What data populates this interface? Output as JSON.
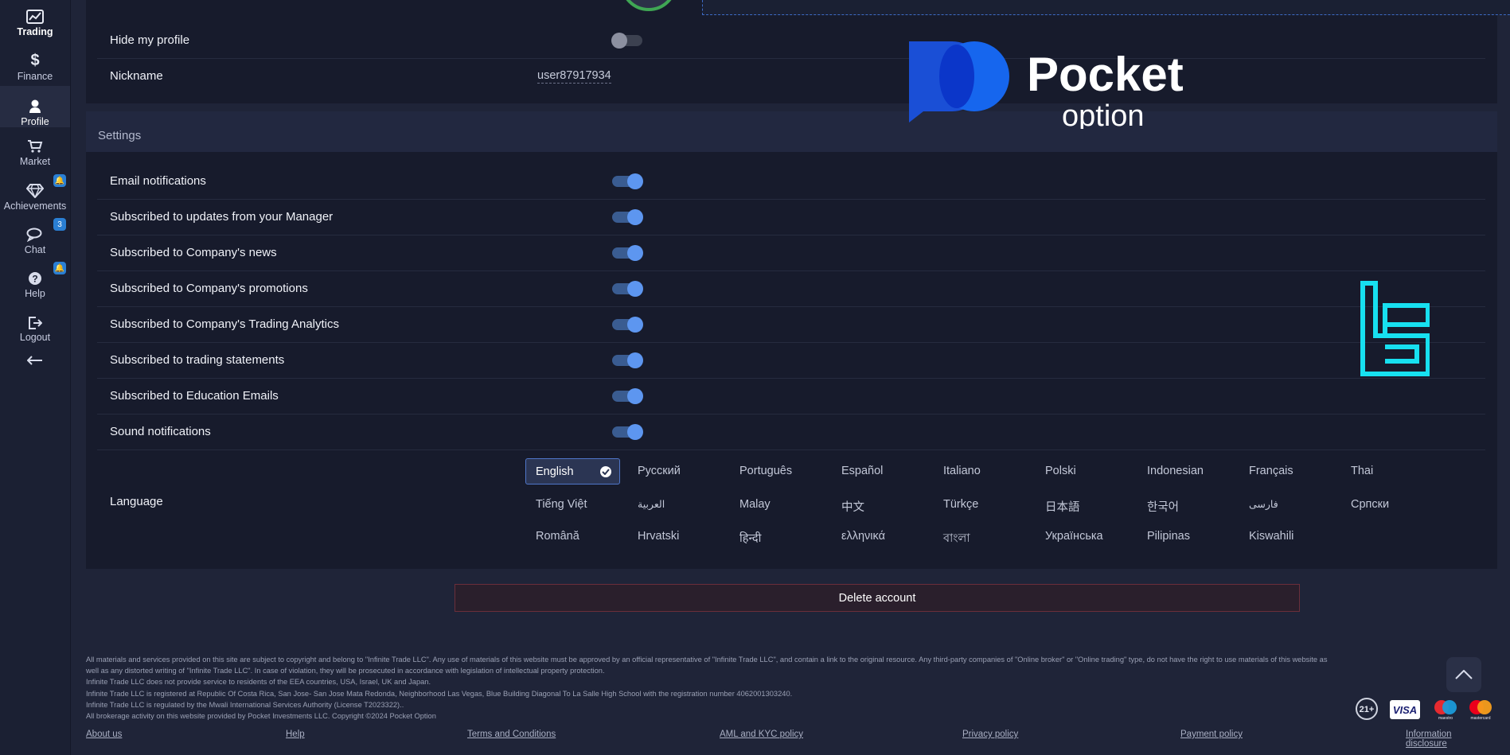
{
  "sidebar": {
    "items": [
      {
        "label": "Trading",
        "icon": "trading-chart-icon"
      },
      {
        "label": "Finance",
        "icon": "dollar-icon"
      },
      {
        "label": "Profile",
        "icon": "user-icon"
      },
      {
        "label": "Market",
        "icon": "cart-icon"
      },
      {
        "label": "Achievements",
        "icon": "diamond-icon"
      },
      {
        "label": "Chat",
        "icon": "chat-icon",
        "badge": "3"
      },
      {
        "label": "Help",
        "icon": "help-icon"
      },
      {
        "label": "Logout",
        "icon": "logout-icon"
      }
    ],
    "active": "Profile",
    "collapse_icon": "arrow-left-icon"
  },
  "profile": {
    "hide_label": "Hide my profile",
    "hide_enabled": false,
    "nickname_label": "Nickname",
    "nickname_value": "user87917934"
  },
  "brand": {
    "word1": "Pocket",
    "word2": "option"
  },
  "settings": {
    "title": "Settings",
    "items": [
      {
        "label": "Email notifications",
        "enabled": true
      },
      {
        "label": "Subscribed to updates from your Manager",
        "enabled": true
      },
      {
        "label": "Subscribed to Company's news",
        "enabled": true
      },
      {
        "label": "Subscribed to Company's promotions",
        "enabled": true
      },
      {
        "label": "Subscribed to Company's Trading Analytics",
        "enabled": true
      },
      {
        "label": "Subscribed to trading statements",
        "enabled": true
      },
      {
        "label": "Subscribed to Education Emails",
        "enabled": true
      },
      {
        "label": "Sound notifications",
        "enabled": true
      }
    ],
    "language_label": "Language",
    "selected_language": "English",
    "languages": [
      "English",
      "Русский",
      "Português",
      "Español",
      "Italiano",
      "Polski",
      "Indonesian",
      "Français",
      "Thai",
      "Tiếng Việt",
      "العربية",
      "Malay",
      "中文",
      "Türkçe",
      "日本語",
      "한국어",
      "فارسی",
      "Српски",
      "Română",
      "Hrvatski",
      "हिन्दी",
      "ελληνικά",
      "বাংলা",
      "Українська",
      "Pilipinas",
      "Kiswahili"
    ]
  },
  "delete_account": "Delete account",
  "disclaimer": [
    "All materials and services provided on this site are subject to copyright and belong to \"Infinite Trade LLC\". Any use of materials of this website must be approved by an official representative of \"Infinite Trade LLC\", and contain a link to the original resource. Any third-party companies of \"Online broker\" or \"Online trading\" type, do not have the right to use materials of this website as",
    "well as any distorted writing of \"Infinite Trade LLC\". In case of violation, they will be prosecuted in accordance with legislation of intellectual property protection.",
    "Infinite Trade LLC does not provide service to residents of the EEA countries, USA, Israel, UK and Japan.",
    "Infinite Trade LLC is registered at Republic Of Costa Rica, San Jose- San Jose Mata Redonda, Neighborhood Las Vegas, Blue Building Diagonal To La Salle High School with the registration number 4062001303240.",
    "Infinite Trade LLC is regulated by the Mwali International Services Authority (License T2023322)..",
    "All brokerage activity on this website provided by Pocket Investments LLC. Copyright ©2024 Pocket Option"
  ],
  "footer_links": [
    "About us",
    "Help",
    "Terms and Conditions",
    "AML and KYC policy",
    "Privacy policy",
    "Payment policy",
    "Information disclosure"
  ],
  "payment": {
    "age": "21+",
    "visa": "VISA",
    "maestro": "maestro",
    "mastercard": "mastercard"
  },
  "colors": {
    "accent": "#5d96f0",
    "background": "#1f2438",
    "panel": "#171b2c",
    "brand_blue": "#1a4fd6"
  }
}
